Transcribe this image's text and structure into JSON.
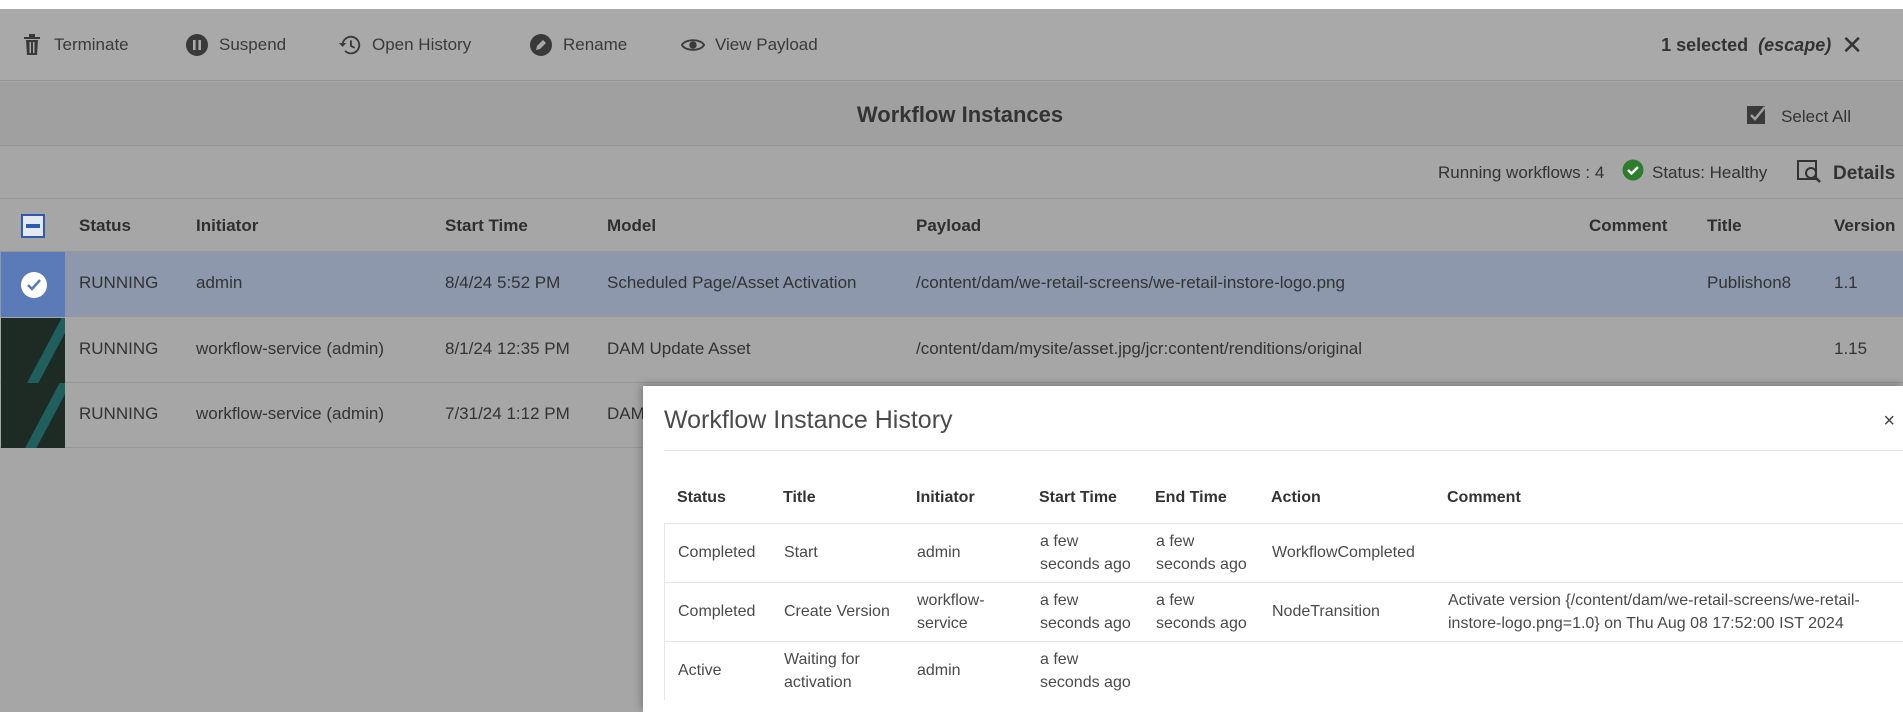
{
  "actionbar": {
    "actions": [
      {
        "label": "Terminate",
        "icon": "trash-icon"
      },
      {
        "label": "Suspend",
        "icon": "pause-icon"
      },
      {
        "label": "Open History",
        "icon": "history-icon"
      },
      {
        "label": "Rename",
        "icon": "pencil-icon"
      },
      {
        "label": "View Payload",
        "icon": "eye-icon"
      }
    ],
    "selection_text": "1 selected",
    "escape_hint": "(escape)"
  },
  "page": {
    "title": "Workflow Instances",
    "select_all": "Select All"
  },
  "status": {
    "running": "Running workflows : 4",
    "health": "Status: Healthy",
    "details": "Details",
    "health_color": "#2d7d2d"
  },
  "table": {
    "columns": [
      "Status",
      "Initiator",
      "Start Time",
      "Model",
      "Payload",
      "Comment",
      "Title",
      "Version"
    ],
    "rows": [
      {
        "status": "RUNNING",
        "initiator": "admin",
        "start": "8/4/24 5:52 PM",
        "model": "Scheduled Page/Asset Activation",
        "payload": "/content/dam/we-retail-screens/we-retail-instore-logo.png",
        "comment": "",
        "title": "Publishon8",
        "version": "1.1",
        "selected": true
      },
      {
        "status": "RUNNING",
        "initiator": "workflow-service (admin)",
        "start": "8/1/24 12:35 PM",
        "model": "DAM Update Asset",
        "payload": "/content/dam/mysite/asset.jpg/jcr:content/renditions/original",
        "comment": "",
        "title": "",
        "version": "1.15",
        "selected": false
      },
      {
        "status": "RUNNING",
        "initiator": "workflow-service (admin)",
        "start": "7/31/24 1:12 PM",
        "model": "DAM",
        "payload": "",
        "comment": "",
        "title": "",
        "version": "",
        "selected": false
      }
    ]
  },
  "dialog": {
    "title": "Workflow Instance History",
    "close": "×",
    "columns": [
      "Status",
      "Title",
      "Initiator",
      "Start Time",
      "End Time",
      "Action",
      "Comment"
    ],
    "rows": [
      {
        "status": "Completed",
        "title": [
          "Start"
        ],
        "initiator": [
          "admin"
        ],
        "start": [
          "a few",
          "seconds ago"
        ],
        "end": [
          "a few",
          "seconds ago"
        ],
        "action": "WorkflowCompleted",
        "comment": []
      },
      {
        "status": "Completed",
        "title": [
          "Create Version"
        ],
        "initiator": [
          "workflow-",
          "service"
        ],
        "start": [
          "a few",
          "seconds ago"
        ],
        "end": [
          "a few",
          "seconds ago"
        ],
        "action": "NodeTransition",
        "comment": [
          "Activate version {/content/dam/we-retail-screens/we-retail-",
          "instore-logo.png=1.0} on Thu Aug 08 17:52:00 IST 2024"
        ]
      },
      {
        "status": "Active",
        "title": [
          "Waiting for",
          "activation"
        ],
        "initiator": [
          "admin"
        ],
        "start": [
          "a few",
          "seconds ago"
        ],
        "end": [],
        "action": "",
        "comment": []
      }
    ]
  },
  "colors": {
    "selected_row": "#8d98ad",
    "accent": "#2d5bb0"
  }
}
